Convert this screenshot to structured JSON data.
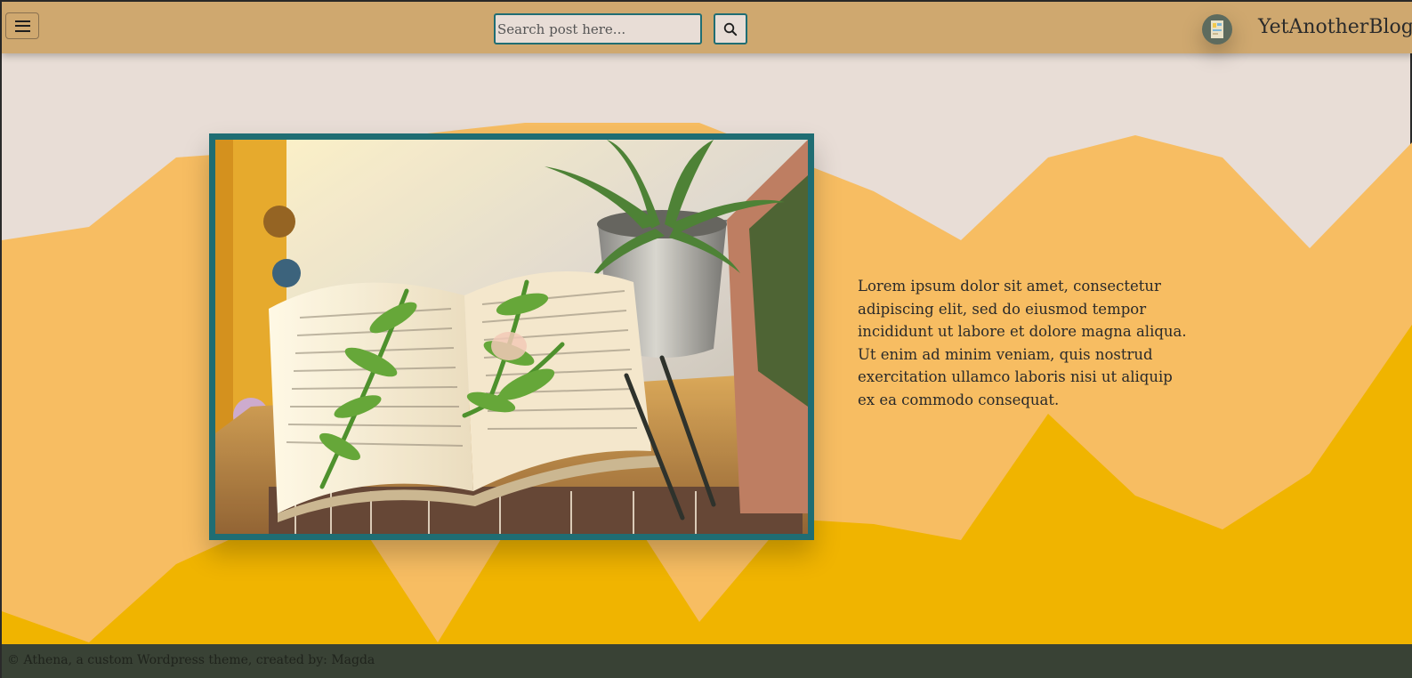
{
  "header": {
    "menu_icon": "hamburger-menu-icon",
    "search": {
      "placeholder": "Search post here...",
      "value": ""
    },
    "search_icon": "magnifier-icon",
    "logo_icon": "book-logo-icon",
    "site_title": "YetAnotherBlog"
  },
  "hero": {
    "image_subject": "open book with fern sprigs beside potted succulent",
    "excerpt": "Lorem ipsum dolor sit amet, consectetur adipiscing elit, sed do eiusmod tempor incididunt ut labore et dolore magna aliqua. Ut enim ad minim veniam, quis nostrud exercitation ullamco laboris nisi ut aliquip ex ea commodo consequat."
  },
  "footer": {
    "copyright": "© Athena, a custom Wordpress theme, created by: Magda"
  },
  "colors": {
    "header_bg": "#cfa86f",
    "page_bg": "#e8ddd6",
    "wave_light": "#f7bd62",
    "wave_dark": "#f0b400",
    "frame_teal": "#1f6d73",
    "footer_bg": "#394235"
  }
}
